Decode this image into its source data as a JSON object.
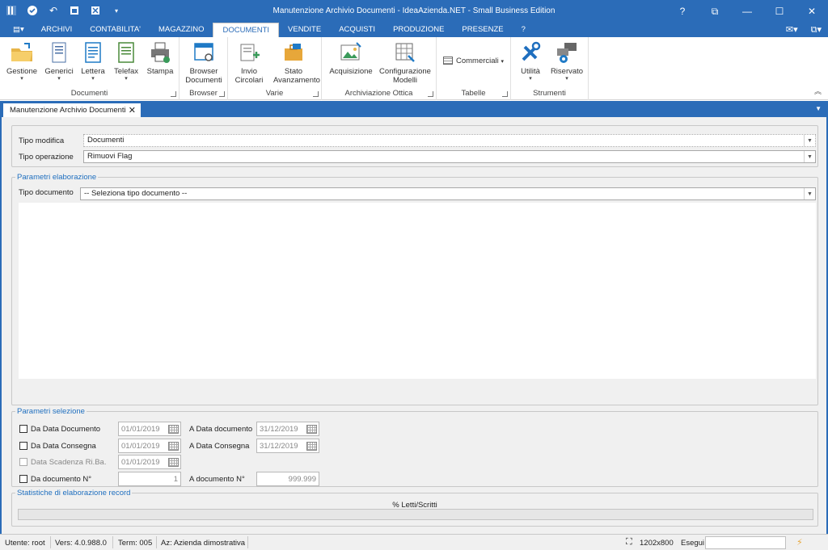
{
  "window": {
    "title": "Manutenzione Archivio Documenti - IdeaAzienda.NET - Small Business Edition",
    "controls": [
      "?",
      "⧉",
      "—",
      "☐",
      "✕"
    ]
  },
  "quick_access": [
    "app-icon",
    "check-icon",
    "undo-icon",
    "calendar-icon",
    "close-doc-icon",
    "dropdown-icon"
  ],
  "menu": {
    "items": [
      "ARCHIVI",
      "CONTABILITA'",
      "MAGAZZINO",
      "DOCUMENTI",
      "VENDITE",
      "ACQUISTI",
      "PRODUZIONE",
      "PRESENZE",
      "?"
    ],
    "active": "DOCUMENTI"
  },
  "ribbon": {
    "groups": [
      {
        "label": "Documenti",
        "buttons": [
          "Gestione",
          "Generici",
          "Lettera",
          "Telefax",
          "Stampa"
        ]
      },
      {
        "label": "Browser",
        "buttons": [
          "Browser Documenti"
        ]
      },
      {
        "label": "Varie",
        "buttons": [
          "Invio Circolari",
          "Stato Avanzamento"
        ]
      },
      {
        "label": "Archiviazione Ottica",
        "buttons": [
          "Acquisizione",
          "Configurazione Modelli"
        ]
      },
      {
        "label": "Tabelle",
        "buttons": [
          "Commerciali"
        ]
      },
      {
        "label": "Strumenti",
        "buttons": [
          "Utilità",
          "Riservato"
        ]
      }
    ]
  },
  "tab": {
    "label": "Manutenzione Archivio Documenti"
  },
  "form": {
    "tipo_modifica_label": "Tipo modifica",
    "tipo_modifica_value": "Documenti",
    "tipo_operazione_label": "Tipo operazione",
    "tipo_operazione_value": "Rimuovi Flag",
    "parametri_elaborazione_legend": "Parametri elaborazione",
    "tipo_documento_label": "Tipo documento",
    "tipo_documento_value": "-- Seleziona tipo documento --",
    "parametri_selezione_legend": "Parametri selezione",
    "da_data_documento_label": "Da Data Documento",
    "da_data_documento_value": "01/01/2019",
    "a_data_documento_label": "A Data documento",
    "a_data_documento_value": "31/12/2019",
    "da_data_consegna_label": "Da Data Consegna",
    "da_data_consegna_value": "01/01/2019",
    "a_data_consegna_label": "A Data Consegna",
    "a_data_consegna_value": "31/12/2019",
    "data_scadenza_label": "Data Scadenza Ri.Ba.",
    "data_scadenza_value": "01/01/2019",
    "da_documento_label": "Da documento N°",
    "da_documento_value": "1",
    "a_documento_label": "A documento N°",
    "a_documento_value": "999.999",
    "statistiche_legend": "Statistiche di elaborazione record",
    "progress_label": "% Letti/Scritti",
    "progress_value": 0
  },
  "status": {
    "utente": "Utente: root",
    "versione": "Vers: 4.0.988.0",
    "terminale": "Term: 005",
    "azienda": "Az: Azienda dimostrativa",
    "risoluzione": "1202x800",
    "esegui": "Esegui"
  },
  "colors": {
    "accent": "#2b6cb8",
    "legend": "#1f6fbf"
  }
}
